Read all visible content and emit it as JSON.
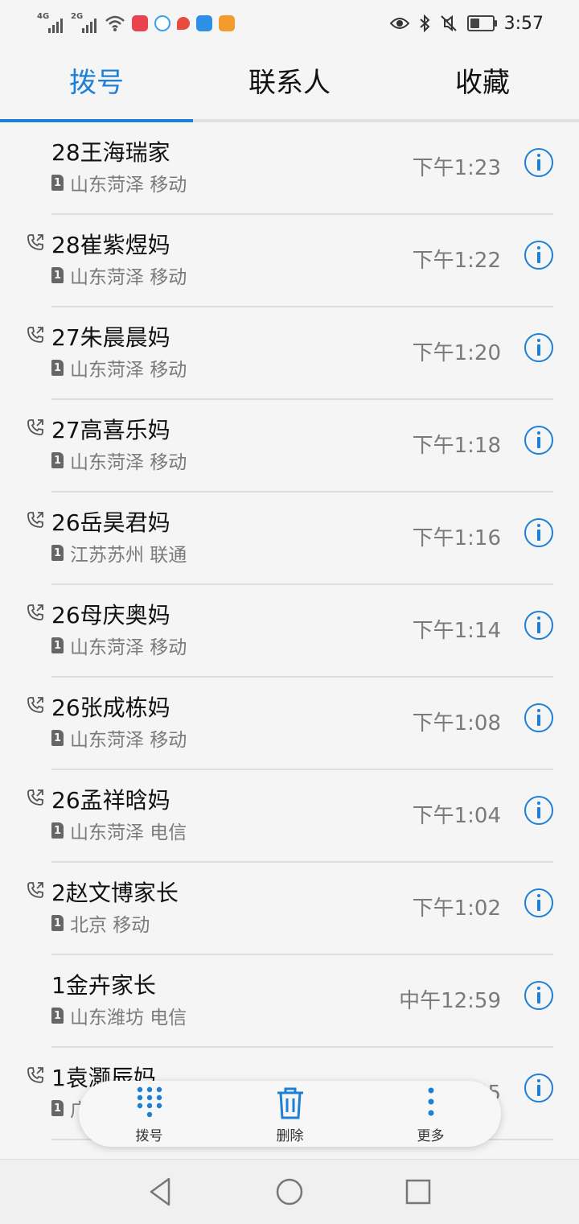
{
  "status_bar": {
    "signal1_label": "4G",
    "signal2_label": "2G",
    "time": "3:57",
    "battery_level": 0.45,
    "icons": [
      "wifi-icon",
      "app-icon",
      "app-icon",
      "app-icon",
      "zhihu-icon",
      "uc-icon",
      "eye-icon",
      "bluetooth-icon",
      "mute-icon",
      "battery-icon"
    ]
  },
  "tabs": [
    {
      "label": "拨号",
      "active": true
    },
    {
      "label": "联系人",
      "active": false
    },
    {
      "label": "收藏",
      "active": false
    }
  ],
  "calls": [
    {
      "name": "28王海瑞家",
      "sim": "1",
      "location": "山东菏泽 移动",
      "time": "下午1:23",
      "outgoing": false
    },
    {
      "name": "28崔紫煜妈",
      "sim": "1",
      "location": "山东菏泽 移动",
      "time": "下午1:22",
      "outgoing": true
    },
    {
      "name": "27朱晨晨妈",
      "sim": "1",
      "location": "山东菏泽 移动",
      "time": "下午1:20",
      "outgoing": true
    },
    {
      "name": "27高喜乐妈",
      "sim": "1",
      "location": "山东菏泽 移动",
      "time": "下午1:18",
      "outgoing": true
    },
    {
      "name": "26岳昊君妈",
      "sim": "1",
      "location": "江苏苏州 联通",
      "time": "下午1:16",
      "outgoing": true
    },
    {
      "name": "26母庆奥妈",
      "sim": "1",
      "location": "山东菏泽 移动",
      "time": "下午1:14",
      "outgoing": true
    },
    {
      "name": "26张成栋妈",
      "sim": "1",
      "location": "山东菏泽 移动",
      "time": "下午1:08",
      "outgoing": true
    },
    {
      "name": "26孟祥晗妈",
      "sim": "1",
      "location": "山东菏泽 电信",
      "time": "下午1:04",
      "outgoing": true
    },
    {
      "name": "2赵文博家长",
      "sim": "1",
      "location": "北京 移动",
      "time": "下午1:02",
      "outgoing": true
    },
    {
      "name": "1金卉家长",
      "sim": "1",
      "location": "山东潍坊 电信",
      "time": "中午12:59",
      "outgoing": false
    },
    {
      "name": "1袁灏辰妈",
      "sim": "1",
      "location": "广东深圳 联通",
      "time": "中午12:55",
      "outgoing": true
    }
  ],
  "toolbar": {
    "dial_label": "拨号",
    "delete_label": "删除",
    "more_label": "更多"
  },
  "colors": {
    "accent": "#1e7fd6",
    "secondary_text": "#7a7a7a"
  }
}
